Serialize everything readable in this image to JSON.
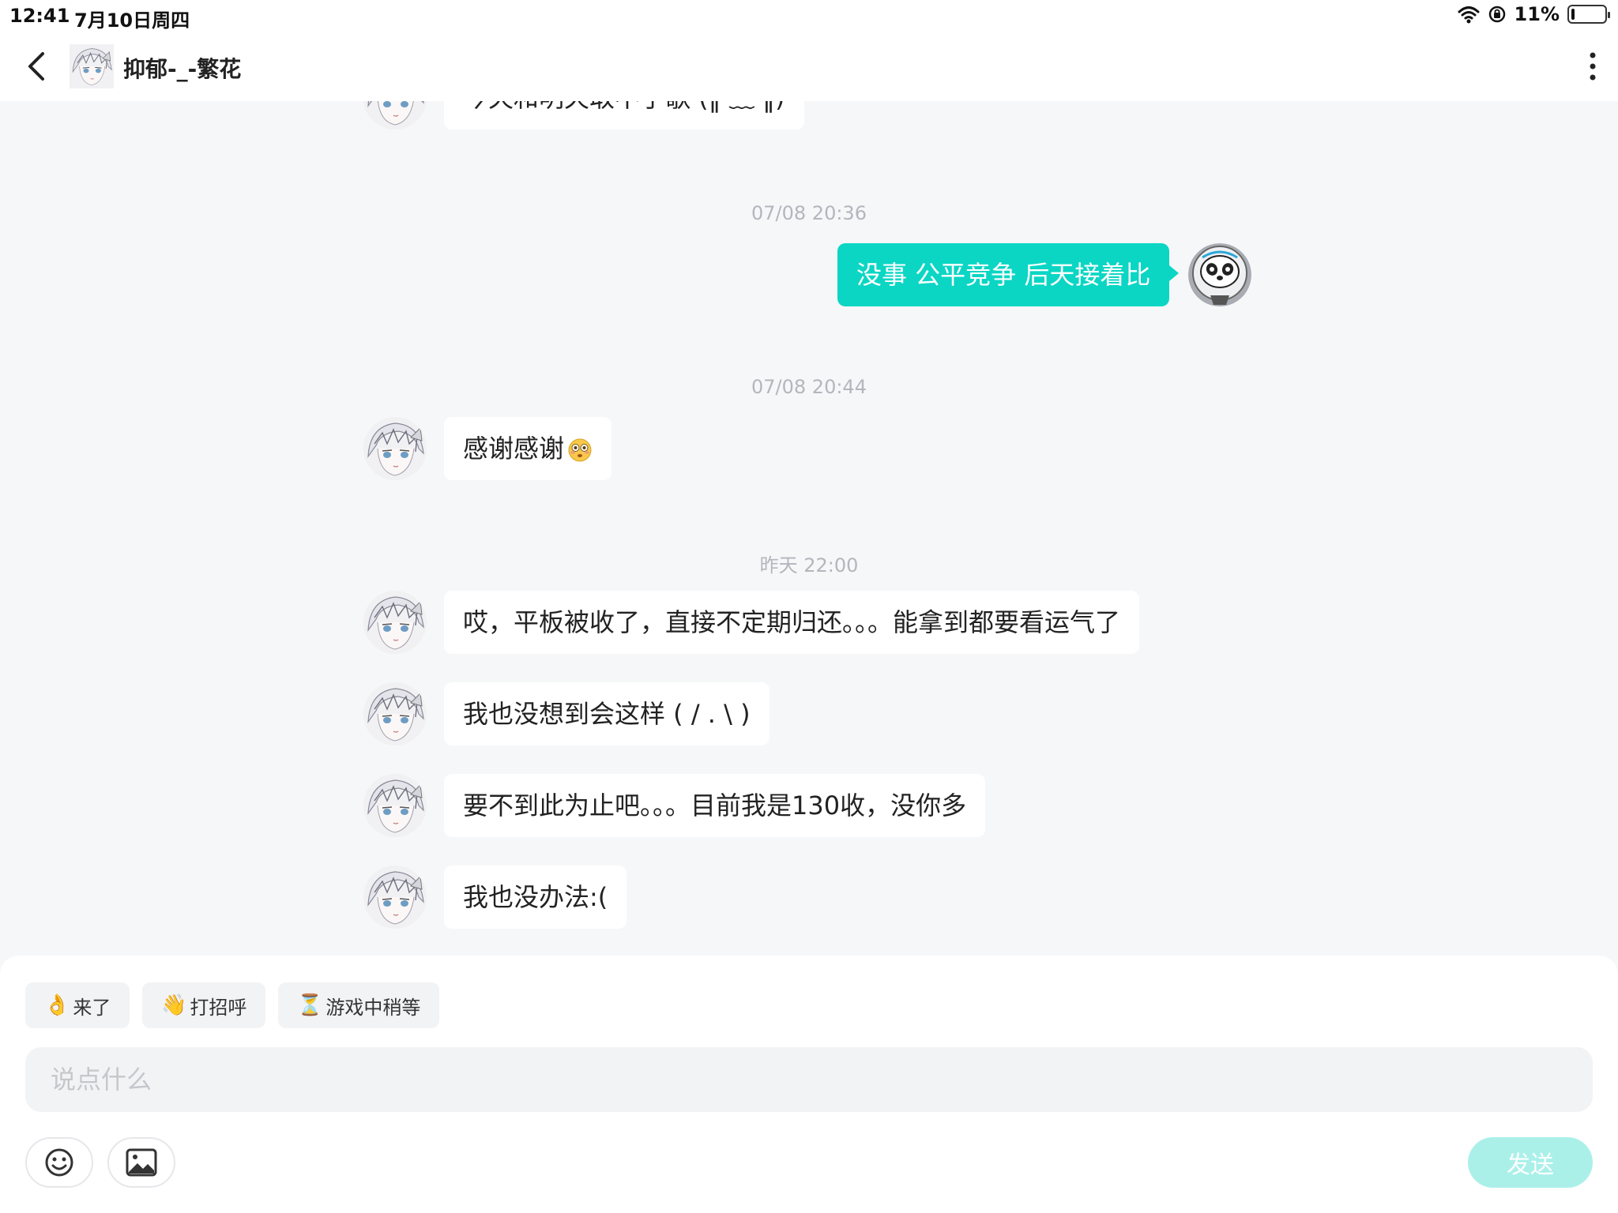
{
  "status_bar": {
    "time": "12:41",
    "date": "7月10日周四",
    "battery": "11%",
    "battery_level": 0.11,
    "icons": [
      "wifi-icon",
      "orientation-lock-icon",
      "battery-icon"
    ]
  },
  "header": {
    "title": "抑郁-_-繁花",
    "icons": [
      "back-icon",
      "avatar",
      "more-vertical-icon"
    ]
  },
  "messages": {
    "partial_top": "今天和明天取不了歌 (‖ ﹏ ‖)",
    "t1": "07/08 20:36",
    "out1": "没事 公平竞争 后天接着比",
    "t2": "07/08 20:44",
    "in1": "感谢感谢",
    "t3": "昨天 22:00",
    "in2": "哎，平板被收了，直接不定期归还。。。能拿到都要看运气了",
    "in3": "我也没想到会这样 ( / . \\ )",
    "in4": "要不到此为止吧。。。目前我是130收，没你多",
    "in5": "我也没办法:("
  },
  "quick_replies": [
    {
      "emoji": "👌",
      "label": "来了"
    },
    {
      "emoji": "👋",
      "label": "打招呼"
    },
    {
      "emoji": "⏳",
      "label": "游戏中稍等"
    }
  ],
  "input": {
    "placeholder": "说点什么"
  },
  "toolbar": {
    "send_label": "发送",
    "icons": [
      "emoji-icon",
      "image-icon"
    ]
  },
  "colors": {
    "accent": "#0bd6c4",
    "send_disabled": "#aaf0e9",
    "background": "#f6f7f9"
  }
}
